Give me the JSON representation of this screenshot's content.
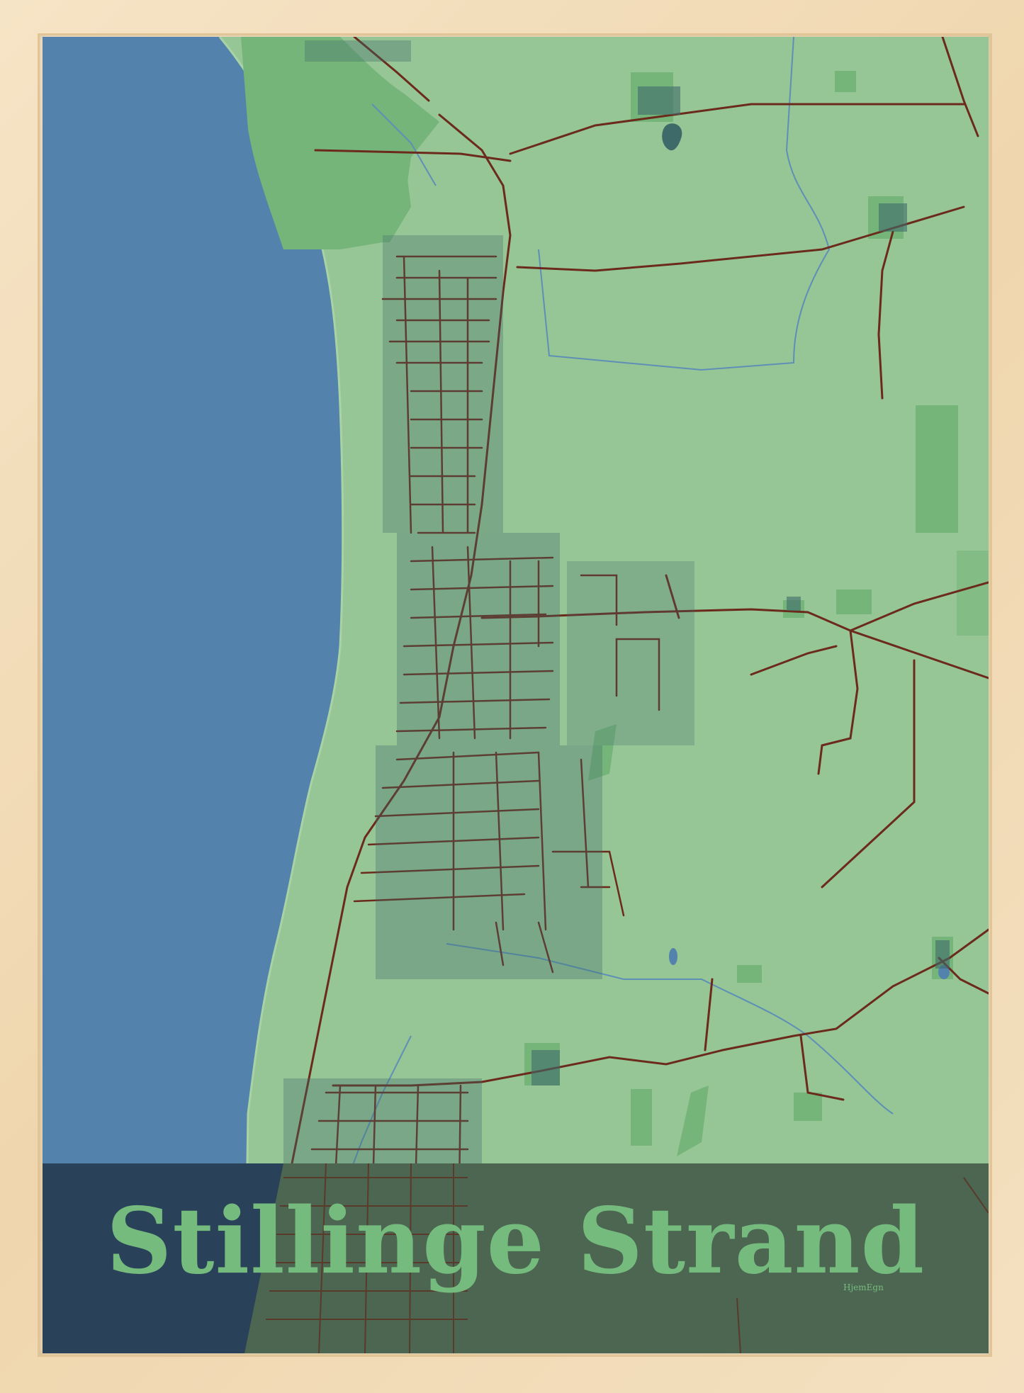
{
  "poster": {
    "title": "Stillinge Strand",
    "brand": "HjemEgn"
  },
  "colors": {
    "frame": "#f3dfbf",
    "sea": "#5383ad",
    "land": "#96c596",
    "forest": "#76b57a",
    "buildings": "#3f6a6a",
    "roads": "#6b2a1c",
    "water_lines": "#5f8fb7",
    "band_sea": "#2a415a",
    "band_land": "#4c6651",
    "title_text": "#76bb7e"
  }
}
